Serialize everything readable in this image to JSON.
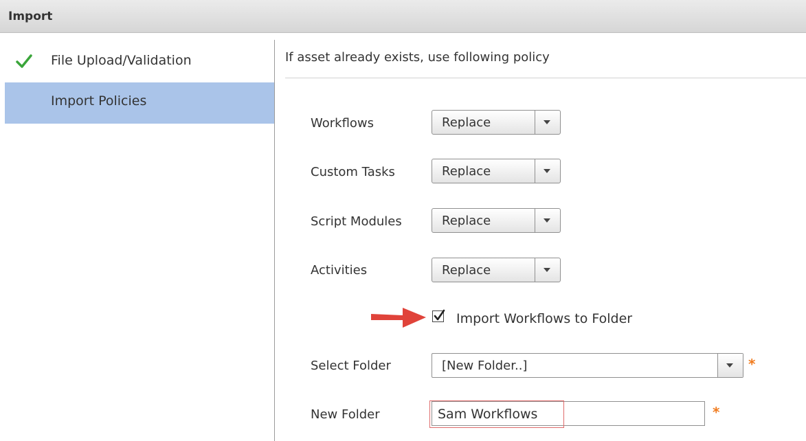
{
  "window": {
    "title": "Import"
  },
  "sidebar": {
    "items": [
      {
        "label": "File Upload/Validation",
        "icon": "checkmark-icon",
        "completed": true
      },
      {
        "label": "Import Policies",
        "active": true
      }
    ]
  },
  "main": {
    "header": "If asset already exists, use following policy",
    "policies": [
      {
        "label": "Workflows",
        "value": "Replace"
      },
      {
        "label": "Custom Tasks",
        "value": "Replace"
      },
      {
        "label": "Script Modules",
        "value": "Replace"
      },
      {
        "label": "Activities",
        "value": "Replace"
      }
    ],
    "import_to_folder": {
      "label": "Import Workflows to Folder",
      "checked": true
    },
    "select_folder": {
      "label": "Select Folder",
      "value": "[New Folder..]",
      "required_mark": "*"
    },
    "new_folder": {
      "label": "New Folder",
      "value": "Sam Workflows",
      "required_mark": "*"
    }
  },
  "colors": {
    "sidebar_active": "#aac4e9",
    "check_green": "#3aa53a",
    "required": "#f07b1e",
    "annotation_arrow": "#e0433a"
  }
}
